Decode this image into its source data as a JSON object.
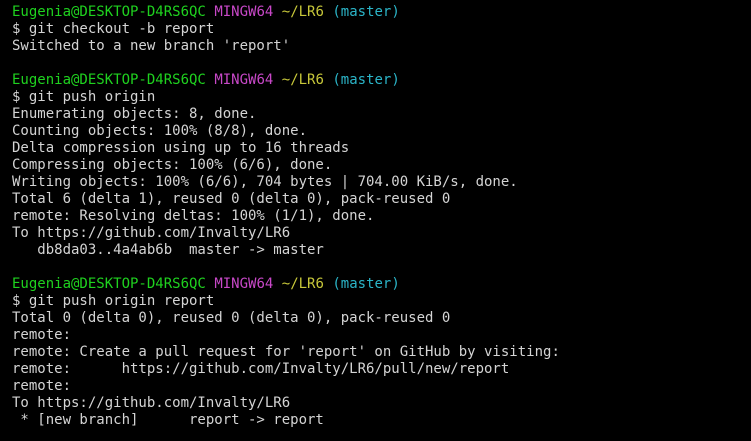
{
  "terminal": {
    "blocks": [
      {
        "prompt": {
          "user": "Eugenia@DESKTOP-D4RS6QC",
          "system": "MINGW64",
          "path": "~/LR6",
          "branch": "(master)"
        },
        "command": "$ git checkout -b report",
        "output": [
          "Switched to a new branch 'report'"
        ]
      },
      {
        "prompt": {
          "user": "Eugenia@DESKTOP-D4RS6QC",
          "system": "MINGW64",
          "path": "~/LR6",
          "branch": "(master)"
        },
        "command": "$ git push origin",
        "output": [
          "Enumerating objects: 8, done.",
          "Counting objects: 100% (8/8), done.",
          "Delta compression using up to 16 threads",
          "Compressing objects: 100% (6/6), done.",
          "Writing objects: 100% (6/6), 704 bytes | 704.00 KiB/s, done.",
          "Total 6 (delta 1), reused 0 (delta 0), pack-reused 0",
          "remote: Resolving deltas: 100% (1/1), done.",
          "To https://github.com/Invalty/LR6",
          "   db8da03..4a4ab6b  master -> master"
        ]
      },
      {
        "prompt": {
          "user": "Eugenia@DESKTOP-D4RS6QC",
          "system": "MINGW64",
          "path": "~/LR6",
          "branch": "(master)"
        },
        "command": "$ git push origin report",
        "output": [
          "Total 0 (delta 0), reused 0 (delta 0), pack-reused 0",
          "remote:",
          "remote: Create a pull request for 'report' on GitHub by visiting:",
          "remote:      https://github.com/Invalty/LR6/pull/new/report",
          "remote:",
          "To https://github.com/Invalty/LR6",
          " * [new branch]      report -> report"
        ]
      }
    ]
  },
  "colors": {
    "background": "#000000",
    "user": "#1fd21f",
    "system": "#c848c8",
    "path": "#c8c83a",
    "branch": "#2bb5c8",
    "text": "#d4d4d4"
  }
}
